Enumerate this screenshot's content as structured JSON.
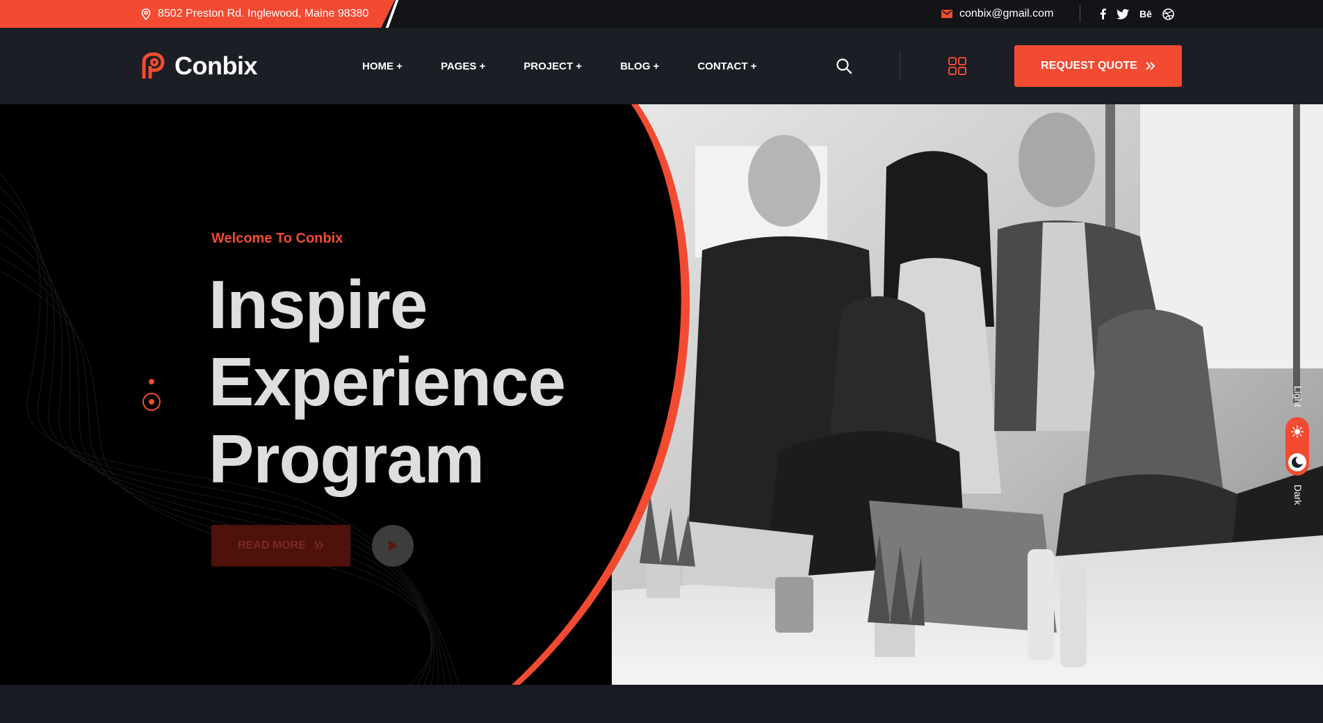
{
  "topbar": {
    "address": "8502 Preston Rd. Inglewood, Maine 98380",
    "email": "conbix@gmail.com",
    "socials": [
      {
        "name": "facebook-icon",
        "glyph": "f"
      },
      {
        "name": "twitter-icon",
        "glyph": ""
      },
      {
        "name": "behance-icon",
        "glyph": "Bē"
      },
      {
        "name": "dribbble-icon",
        "glyph": ""
      }
    ]
  },
  "header": {
    "logo_text": "Conbix",
    "nav": [
      {
        "label": "HOME +"
      },
      {
        "label": "PAGES +"
      },
      {
        "label": "PROJECT +"
      },
      {
        "label": "BLOG +"
      },
      {
        "label": "CONTACT +"
      }
    ],
    "quote_button": "REQUEST QUOTE"
  },
  "hero": {
    "welcome": "Welcome To Conbix",
    "title_lines": [
      "Inspire",
      "Experience",
      "Program"
    ],
    "read_more": "READ MORE"
  },
  "theme_toggle": {
    "light": "Light",
    "dark": "Dark"
  },
  "colors": {
    "accent": "#f24b32",
    "topbar_bg": "#121417",
    "header_bg": "#1b1e24",
    "hero_bg": "#000000"
  }
}
